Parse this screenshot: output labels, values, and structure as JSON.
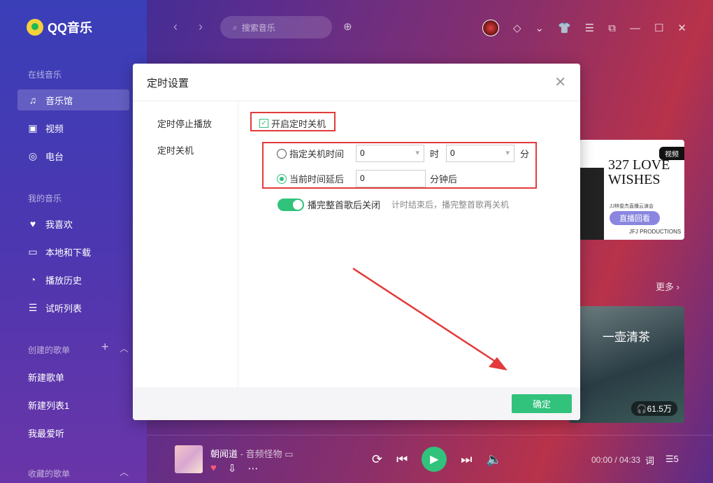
{
  "app": {
    "name": "QQ音乐"
  },
  "search": {
    "placeholder": "搜索音乐"
  },
  "sidebar": {
    "section_online": "在线音乐",
    "online_items": [
      {
        "label": "音乐馆",
        "icon": "music-note-icon"
      },
      {
        "label": "视频",
        "icon": "video-icon"
      },
      {
        "label": "电台",
        "icon": "radio-icon"
      }
    ],
    "section_mine": "我的音乐",
    "mine_items": [
      {
        "label": "我喜欢",
        "icon": "heart-icon"
      },
      {
        "label": "本地和下载",
        "icon": "monitor-icon"
      },
      {
        "label": "播放历史",
        "icon": "history-icon"
      },
      {
        "label": "试听列表",
        "icon": "playlist-icon"
      }
    ],
    "section_created": "创建的歌单",
    "created_items": [
      "新建歌单",
      "新建列表1",
      "我最爱听"
    ],
    "section_collected": "收藏的歌单"
  },
  "cards": {
    "card1_tag": "视频",
    "card1_title": "327 LOVE WISHES",
    "card1_sub": "JJ林俊杰直播云演会",
    "card1_button": "直播回看",
    "card1_producer": "JFJ PRODUCTIONS",
    "more_label": "更多 ›",
    "card2_title": "一壶清茶",
    "card2_plays": "🎧61.5万"
  },
  "player": {
    "song": "朝闻道",
    "artist": "音频怪物",
    "time": "00:00 / 04:33",
    "lyrics_label": "词",
    "queue_count": "5"
  },
  "dialog": {
    "title": "定时设置",
    "nav": [
      "定时停止播放",
      "定时关机"
    ],
    "enable_label": "开启定时关机",
    "option1_label": "指定关机时间",
    "hour_value": "0",
    "hour_unit": "时",
    "minute_value": "0",
    "minute_unit": "分",
    "option2_label": "当前时间延后",
    "delay_value": "0",
    "delay_unit": "分钟后",
    "finish_label": "播完整首歌后关闭",
    "finish_hint": "计时结束后，播完整首歌再关机",
    "confirm_label": "确定"
  },
  "colors": {
    "accent": "#31c27c",
    "highlight": "#e23a3a"
  }
}
